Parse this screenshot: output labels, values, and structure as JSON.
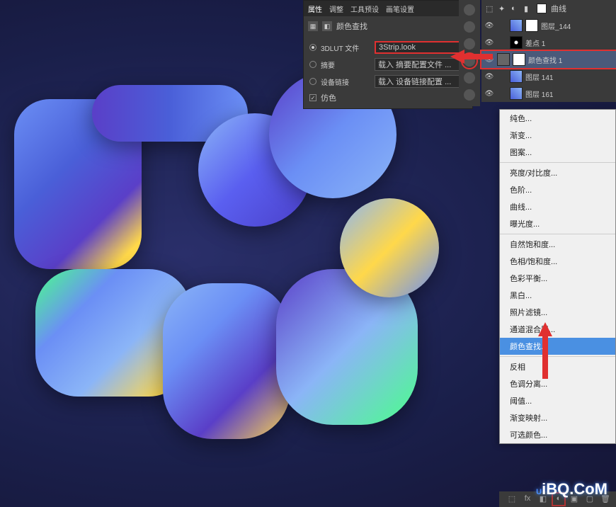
{
  "properties_panel": {
    "tabs": [
      "属性",
      "调整",
      "工具预设",
      "画笔设置"
    ],
    "title": "颜色查找",
    "rows": {
      "lut_label": "3DLUT 文件",
      "lut_value": "3Strip.look",
      "abstract_label": "摘要",
      "abstract_value": "载入 摘要配置文件 ...",
      "device_label": "设备链接",
      "device_value": "载入 设备链接配置 ...",
      "dither_label": "仿色"
    }
  },
  "layers": {
    "opts_label": "曲线",
    "items": [
      {
        "name": "图层_144",
        "thumb": "tex",
        "mask": true
      },
      {
        "name": "差点 1",
        "thumb": "dots"
      },
      {
        "name": "颜色查找 1",
        "thumb": "adj",
        "mask": true,
        "hl": true
      },
      {
        "name": "图层  141",
        "thumb": "tex"
      },
      {
        "name": "图层  161",
        "thumb": "tex"
      }
    ]
  },
  "adj_menu": {
    "groups": [
      [
        "纯色...",
        "渐变...",
        "图案..."
      ],
      [
        "亮度/对比度...",
        "色阶...",
        "曲线...",
        "曝光度..."
      ],
      [
        "自然饱和度...",
        "色相/饱和度...",
        "色彩平衡...",
        "黑白...",
        "照片滤镜...",
        "通道混合器...",
        "颜色查找..."
      ],
      [
        "反相",
        "色调分离...",
        "阈值...",
        "渐变映射...",
        "可选颜色..."
      ]
    ],
    "selected": "颜色查找..."
  },
  "watermark": "UiBQ.CoM"
}
